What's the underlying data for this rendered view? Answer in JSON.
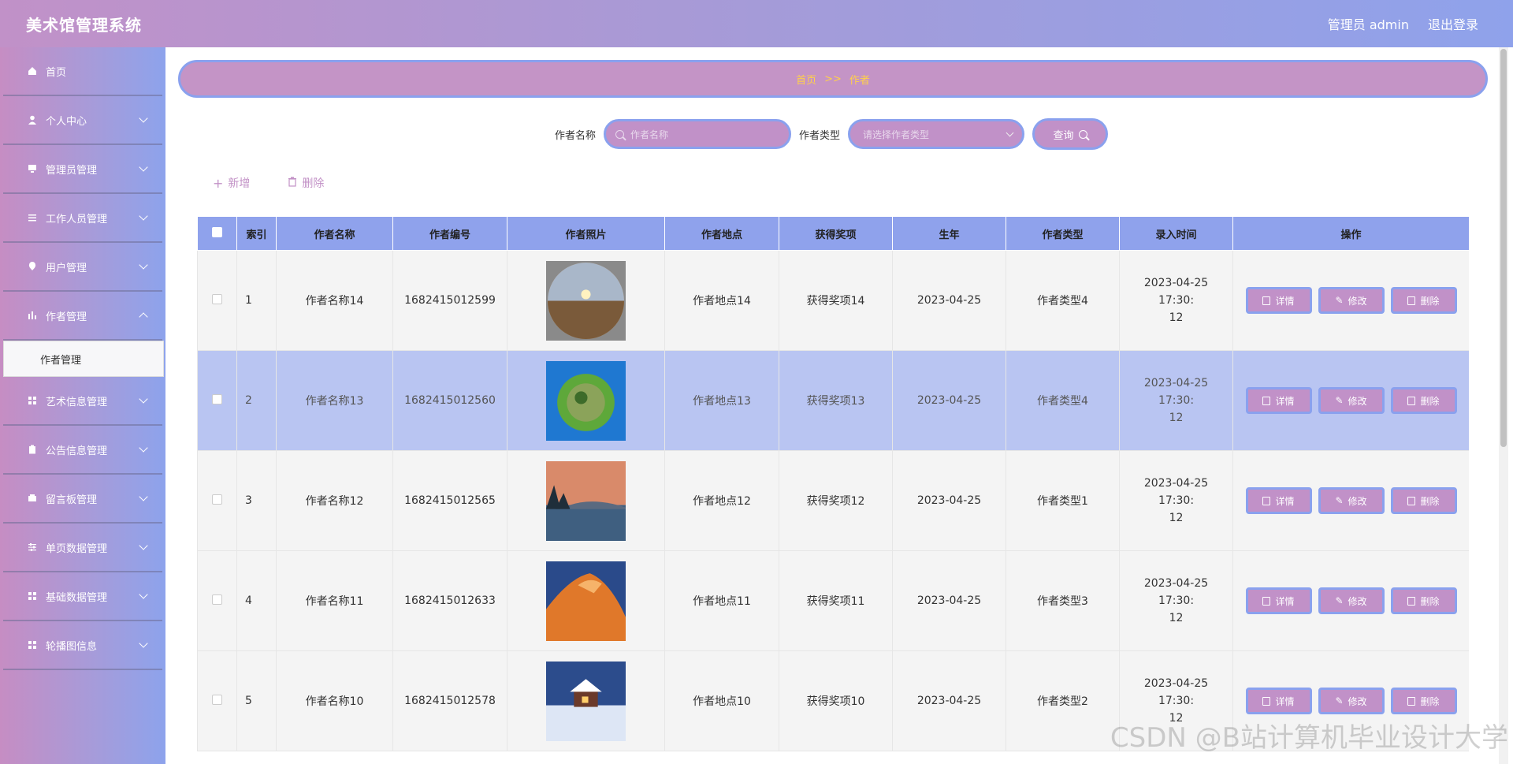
{
  "header": {
    "title": "美术馆管理系统",
    "user": "管理员 admin",
    "logout": "退出登录"
  },
  "sidebar": {
    "items": [
      {
        "label": "首页",
        "icon": "home-icon"
      },
      {
        "label": "个人中心",
        "icon": "user-icon"
      },
      {
        "label": "管理员管理",
        "icon": "monitor-icon"
      },
      {
        "label": "工作人员管理",
        "icon": "list-icon"
      },
      {
        "label": "用户管理",
        "icon": "pin-icon"
      },
      {
        "label": "作者管理",
        "icon": "chart-icon"
      },
      {
        "label": "艺术信息管理",
        "icon": "grid-icon"
      },
      {
        "label": "公告信息管理",
        "icon": "clipboard-icon"
      },
      {
        "label": "留言板管理",
        "icon": "message-icon"
      },
      {
        "label": "单页数据管理",
        "icon": "sliders-icon"
      },
      {
        "label": "基础数据管理",
        "icon": "grid-icon"
      },
      {
        "label": "轮播图信息",
        "icon": "grid-icon"
      }
    ],
    "submenu": "作者管理"
  },
  "breadcrumb": {
    "home": "首页",
    "sep": ">>",
    "current": "作者"
  },
  "search": {
    "name_label": "作者名称",
    "name_placeholder": "作者名称",
    "type_label": "作者类型",
    "type_placeholder": "请选择作者类型",
    "query_label": "查询"
  },
  "actions": {
    "add": "新增",
    "delete": "删除"
  },
  "table": {
    "headers": [
      "索引",
      "作者名称",
      "作者编号",
      "作者照片",
      "作者地点",
      "获得奖项",
      "生年",
      "作者类型",
      "录入时间",
      "操作"
    ],
    "rows": [
      {
        "index": "1",
        "name": "作者名称14",
        "code": "1682415012599",
        "place": "作者地点14",
        "award": "获得奖项14",
        "birth": "2023-04-25",
        "type": "作者类型4",
        "time1": "2023-04-25 17:30:",
        "time2": "12",
        "photo": "sunset"
      },
      {
        "index": "2",
        "name": "作者名称13",
        "code": "1682415012560",
        "place": "作者地点13",
        "award": "获得奖项13",
        "birth": "2023-04-25",
        "type": "作者类型4",
        "time1": "2023-04-25 17:30:",
        "time2": "12",
        "photo": "globe"
      },
      {
        "index": "3",
        "name": "作者名称12",
        "code": "1682415012565",
        "place": "作者地点12",
        "award": "获得奖项12",
        "birth": "2023-04-25",
        "type": "作者类型1",
        "time1": "2023-04-25 17:30:",
        "time2": "12",
        "photo": "lake"
      },
      {
        "index": "4",
        "name": "作者名称11",
        "code": "1682415012633",
        "place": "作者地点11",
        "award": "获得奖项11",
        "birth": "2023-04-25",
        "type": "作者类型3",
        "time1": "2023-04-25 17:30:",
        "time2": "12",
        "photo": "rock"
      },
      {
        "index": "5",
        "name": "作者名称10",
        "code": "1682415012578",
        "place": "作者地点10",
        "award": "获得奖项10",
        "birth": "2023-04-25",
        "type": "作者类型2",
        "time1": "2023-04-25 17:30:",
        "time2": "12",
        "photo": "snow"
      }
    ],
    "op_labels": {
      "detail": "详情",
      "edit": "修改",
      "delete": "删除"
    }
  },
  "watermark": "CSDN @B站计算机毕业设计大学",
  "colors": {
    "accent_pink": "#c191c8",
    "accent_blue": "#8aa1ee",
    "breadcrumb_text": "#ffd04a"
  }
}
